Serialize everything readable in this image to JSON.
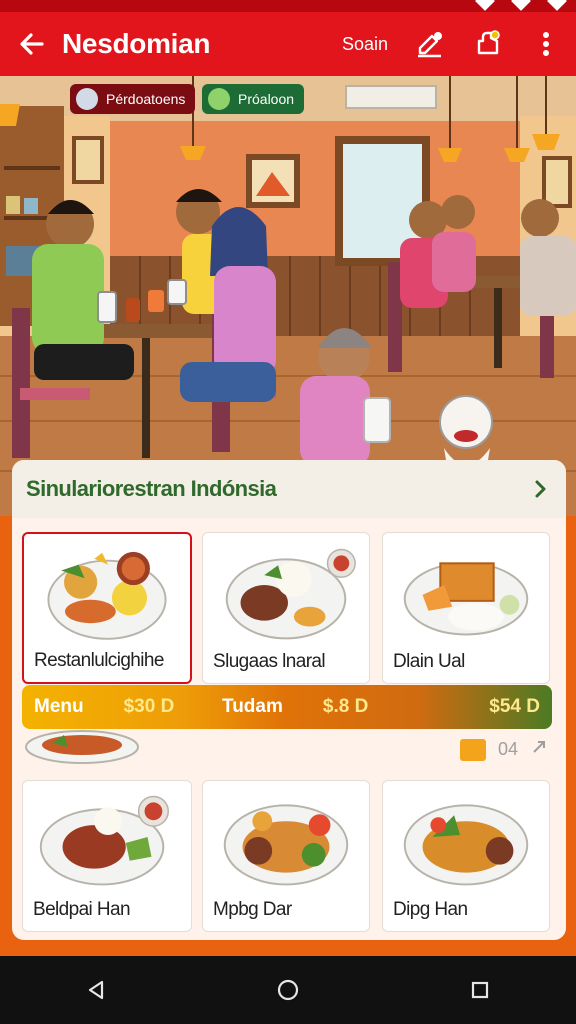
{
  "app_bar": {
    "title": "Nesdomian",
    "search_label": "Soain",
    "background": "#e1151b"
  },
  "icons": {
    "back": "arrow-left-icon",
    "pen": "pen-icon",
    "bag": "bag-icon",
    "more": "more-vert-icon"
  },
  "hero": {
    "chips": [
      {
        "label": "Pérdoatoens",
        "color": "#7b0d12"
      },
      {
        "label": "Próaloon",
        "color": "#1d6b35"
      }
    ]
  },
  "menu": {
    "title": "Sinulariorestran Indónsia",
    "cards": [
      {
        "name": "Restanlulcighihe"
      },
      {
        "name": "Slugaas lnaral"
      },
      {
        "name": "Dlain Ual"
      },
      {
        "name": "Beldpai Han"
      },
      {
        "name": "Mpbg Dar"
      },
      {
        "name": "Dipg Han"
      }
    ],
    "price_bar": [
      {
        "label": "Menu",
        "price": "$30 D"
      },
      {
        "label": "Tudam",
        "price": "$.8 D"
      },
      {
        "label": "",
        "price": "$54 D"
      }
    ],
    "pagination": "04"
  },
  "nav": {
    "back": "nav-back-icon",
    "home": "nav-home-icon",
    "recents": "nav-recents-icon"
  }
}
